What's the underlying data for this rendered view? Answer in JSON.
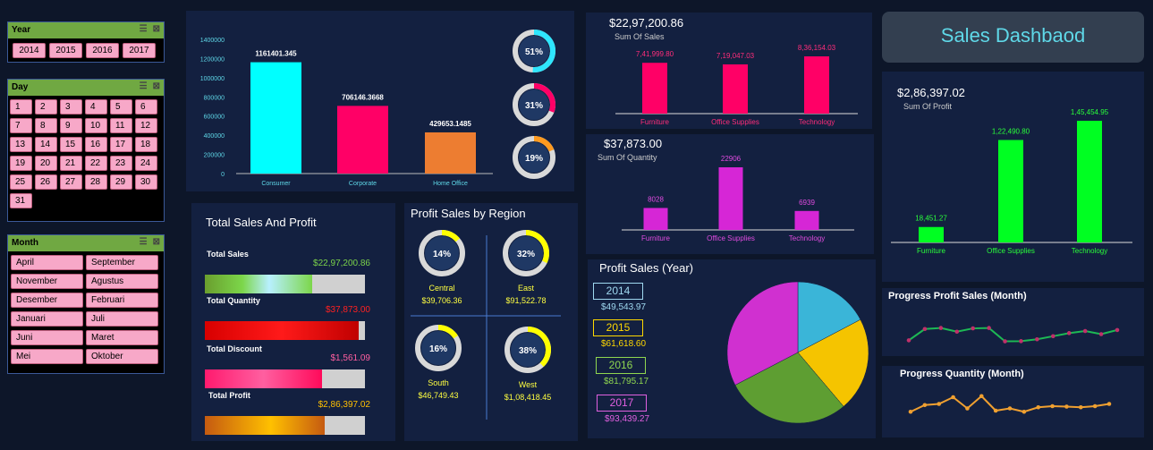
{
  "slicers": {
    "year": {
      "title": "Year",
      "items": [
        "2014",
        "2015",
        "2016",
        "2017"
      ]
    },
    "day": {
      "title": "Day",
      "items": [
        "1",
        "2",
        "3",
        "4",
        "5",
        "6",
        "7",
        "8",
        "9",
        "10",
        "11",
        "12",
        "13",
        "14",
        "15",
        "16",
        "17",
        "18",
        "19",
        "20",
        "21",
        "22",
        "23",
        "24",
        "25",
        "26",
        "27",
        "28",
        "29",
        "30",
        "31"
      ]
    },
    "month": {
      "title": "Month",
      "items": [
        "April",
        "September",
        "November",
        "Agustus",
        "Desember",
        "Februari",
        "Januari",
        "Juli",
        "Juni",
        "Maret",
        "Mei",
        "Oktober"
      ]
    }
  },
  "segment_chart": {
    "ticks": [
      "1400000",
      "1200000",
      "1000000",
      "800000",
      "600000",
      "400000",
      "200000",
      "0"
    ],
    "categories": [
      "Consumer",
      "Corporate",
      "Home Office"
    ],
    "values": [
      1161401.345,
      706146.3668,
      429653.1485
    ],
    "value_labels": [
      "1161401.345",
      "706146.3668",
      "429653.1485"
    ],
    "colors": [
      "#00ffff",
      "#ff0066",
      "#ed7d31"
    ],
    "donuts": [
      {
        "label": "51%",
        "value": 0.51,
        "color": "#2ee6ff"
      },
      {
        "label": "31%",
        "value": 0.31,
        "color": "#ff0066"
      },
      {
        "label": "19%",
        "value": 0.19,
        "color": "#ff9a1f"
      }
    ]
  },
  "sales_category": {
    "total": "$22,97,200.86",
    "subtitle": "Sum Of Sales",
    "categories": [
      "Furniture",
      "Office Supplies",
      "Technology"
    ],
    "values": [
      741999.8,
      719047.03,
      836154.03
    ],
    "value_labels": [
      "7,41,999.80",
      "7,19,047.03",
      "8,36,154.03"
    ]
  },
  "quantity_category": {
    "total": "$37,873.00",
    "subtitle": "Sum Of Quantity",
    "categories": [
      "Furniture",
      "Office Supplies",
      "Technology"
    ],
    "values": [
      8028,
      22906,
      6939
    ],
    "value_labels": [
      "8028",
      "22906",
      "6939"
    ]
  },
  "profit_category": {
    "total": "$2,86,397.02",
    "subtitle": "Sum Of Profit",
    "categories": [
      "Furniture",
      "Office Supplies",
      "Technology"
    ],
    "values": [
      18451.27,
      122490.8,
      145454.95
    ],
    "value_labels": [
      "18,451.27",
      "1,22,490.80",
      "1,45,454.95"
    ]
  },
  "title_box": {
    "title": "Sales Dashbaod"
  },
  "totals": {
    "title": "Total Sales And Profit",
    "rows": [
      {
        "label": "Total Sales",
        "value": "$22,97,200.86",
        "fill": 0.67,
        "value_color": "#7bd34a"
      },
      {
        "label": "Total Quantity",
        "value": "$37,873.00",
        "fill": 0.96,
        "value_color": "#ff2020"
      },
      {
        "label": "Total Discount",
        "value": "$1,561.09",
        "fill": 0.73,
        "value_color": "#ff5fa0"
      },
      {
        "label": "Total Profit",
        "value": "$2,86,397.02",
        "fill": 0.75,
        "value_color": "#ffc000"
      }
    ]
  },
  "region": {
    "title": "Profit Sales by Region",
    "items": [
      {
        "name": "Central",
        "pct": "14%",
        "value": "$39,706.36",
        "frac": 0.14
      },
      {
        "name": "East",
        "pct": "32%",
        "value": "$91,522.78",
        "frac": 0.32
      },
      {
        "name": "South",
        "pct": "16%",
        "value": "$46,749.43",
        "frac": 0.16
      },
      {
        "name": "West",
        "pct": "38%",
        "value": "$1,08,418.45",
        "frac": 0.38
      }
    ]
  },
  "year_profit": {
    "title": "Profit Sales (Year)",
    "items": [
      {
        "year": "2014",
        "value": "$49,543.97",
        "amount": 49543.97,
        "color": "#9fd8f0",
        "pie": "#3ab5d8"
      },
      {
        "year": "2015",
        "value": "$61,618.60",
        "amount": 61618.6,
        "color": "#ffd800",
        "pie": "#f5c400"
      },
      {
        "year": "2016",
        "value": "$81,795.17",
        "amount": 81795.17,
        "color": "#8fd650",
        "pie": "#5e9e32"
      },
      {
        "year": "2017",
        "value": "$93,439.27",
        "amount": 93439.27,
        "color": "#e060e0",
        "pie": "#d030d0"
      }
    ]
  },
  "progress_profit": {
    "title": "Progress Profit Sales (Month)",
    "values": [
      0.2,
      0.75,
      0.8,
      0.62,
      0.78,
      0.8,
      0.15,
      0.16,
      0.25,
      0.4,
      0.55,
      0.65,
      0.5,
      0.7
    ]
  },
  "progress_quantity": {
    "title": "Progress Quantity (Month)",
    "values": [
      0.15,
      0.45,
      0.5,
      0.8,
      0.3,
      0.85,
      0.2,
      0.3,
      0.15,
      0.35,
      0.4,
      0.38,
      0.35,
      0.4,
      0.5
    ]
  }
}
